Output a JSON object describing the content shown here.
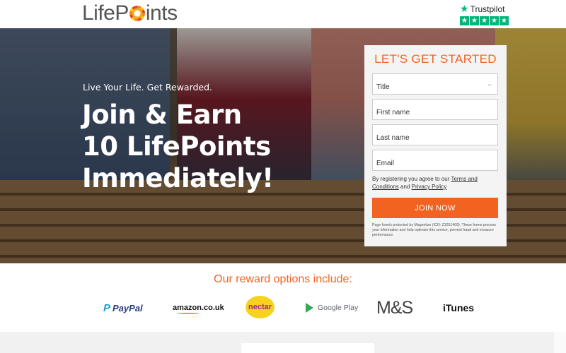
{
  "header": {
    "logo": {
      "left": "Life",
      "right": "ints",
      "sun_letter": "Po"
    },
    "trustpilot": {
      "label": "Trustpilot",
      "rating_stars": 5
    }
  },
  "hero": {
    "tagline": "Live Your Life. Get Rewarded.",
    "headline": [
      "Join & Earn",
      "10 LifePoints",
      "Immediately!"
    ]
  },
  "form": {
    "title": "LET'S GET STARTED",
    "fields": [
      {
        "placeholder": "Title",
        "type": "select"
      },
      {
        "placeholder": "First name",
        "type": "text"
      },
      {
        "placeholder": "Last name",
        "type": "text"
      },
      {
        "placeholder": "Email",
        "type": "email"
      }
    ],
    "terms_prefix": "By registering you agree to our",
    "terms_link": "Terms and Conditions",
    "terms_and": "and",
    "privacy_link": "Privacy Policy",
    "join_label": "JOIN NOW",
    "fine_print": "Page form/s protected by Magnetize (ICO: Z1251409). These forms process your information and help optimize this service, prevent fraud and measure performance."
  },
  "rewards": {
    "heading": "Our reward options include:",
    "logos": {
      "paypal": "PayPal",
      "amazon": "amazon.co.uk",
      "nectar": "nectar",
      "google_play": "Google Play",
      "ms": "M&S",
      "itunes": "iTunes"
    }
  },
  "colors": {
    "accent": "#f26322",
    "trustpilot_green": "#00b67a"
  }
}
